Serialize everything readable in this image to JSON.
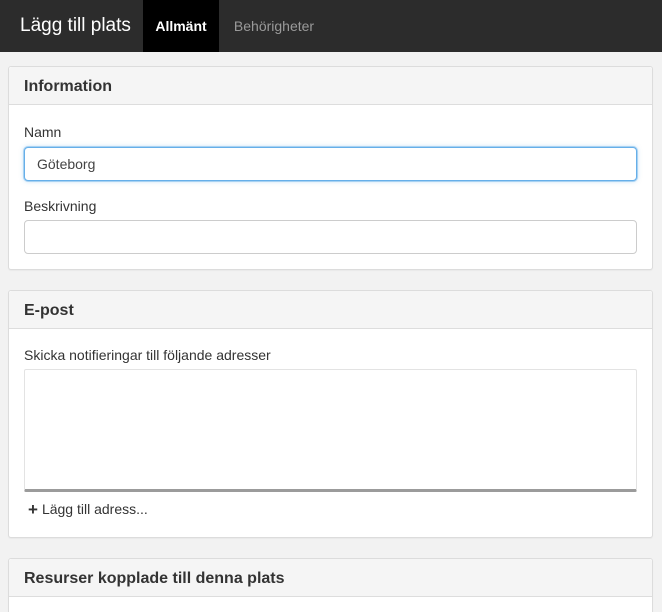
{
  "header": {
    "title": "Lägg till plats",
    "tabs": [
      {
        "label": "Allmänt",
        "active": true
      },
      {
        "label": "Behörigheter",
        "active": false
      }
    ]
  },
  "information": {
    "heading": "Information",
    "name_label": "Namn",
    "name_value": "Göteborg",
    "description_label": "Beskrivning",
    "description_value": ""
  },
  "email": {
    "heading": "E-post",
    "notify_label": "Skicka notifieringar till följande adresser",
    "addresses": [],
    "add_icon": "+",
    "add_label": "Lägg till adress..."
  },
  "resources": {
    "heading": "Resurser kopplade till denna plats"
  },
  "colors": {
    "topbar": "#2c2c2c",
    "active_tab": "#000000",
    "focus_border": "#66afe9",
    "panel_heading_bg": "#f5f5f5"
  }
}
